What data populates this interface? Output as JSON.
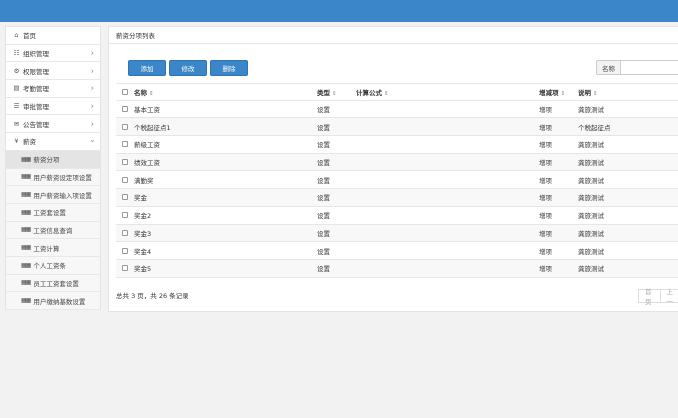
{
  "sidebar": {
    "menu": [
      {
        "label": "首页",
        "icon": "home-icon"
      },
      {
        "label": "组织管理",
        "icon": "org-chart-icon"
      },
      {
        "label": "权限管理",
        "icon": "cogs-icon"
      },
      {
        "label": "考勤管理",
        "icon": "calendar-icon"
      },
      {
        "label": "审批管理",
        "icon": "list-icon"
      },
      {
        "label": "公告管理",
        "icon": "bullhorn-icon"
      },
      {
        "label": "薪资",
        "icon": "yen-icon"
      }
    ],
    "sub_items": [
      {
        "label": "薪资分项"
      },
      {
        "label": "用户薪资设定项设置"
      },
      {
        "label": "用户薪资输入项设置"
      },
      {
        "label": "工资套设置"
      },
      {
        "label": "工资信息查询"
      },
      {
        "label": "工资计算"
      },
      {
        "label": "个人工资条"
      },
      {
        "label": "员工工资套设置"
      },
      {
        "label": "用户缴纳基数设置"
      }
    ]
  },
  "panel": {
    "title": "薪资分项列表",
    "buttons": {
      "add": "添加",
      "edit": "修改",
      "delete": "删除"
    },
    "search": {
      "label": "名称",
      "value": "",
      "placeholder": ""
    }
  },
  "table": {
    "headers": {
      "name": "名称",
      "type": "类型",
      "formula": "计算公式",
      "inc": "增减项",
      "desc": "说明"
    },
    "rows": [
      {
        "name": "基本工资",
        "type": "设置",
        "formula": "",
        "inc": "增项",
        "desc": "龚旅测试"
      },
      {
        "name": "个税起征点1",
        "type": "设置",
        "formula": "",
        "inc": "增项",
        "desc": "个税起征点"
      },
      {
        "name": "薪级工资",
        "type": "设置",
        "formula": "",
        "inc": "增项",
        "desc": "龚旅测试"
      },
      {
        "name": "绩效工资",
        "type": "设置",
        "formula": "",
        "inc": "增项",
        "desc": "龚旅测试"
      },
      {
        "name": "满勤奖",
        "type": "设置",
        "formula": "",
        "inc": "增项",
        "desc": "龚旅测试"
      },
      {
        "name": "奖金",
        "type": "设置",
        "formula": "",
        "inc": "增项",
        "desc": "龚旅测试"
      },
      {
        "name": "奖金2",
        "type": "设置",
        "formula": "",
        "inc": "增项",
        "desc": "龚旅测试"
      },
      {
        "name": "奖金3",
        "type": "设置",
        "formula": "",
        "inc": "增项",
        "desc": "龚旅测试"
      },
      {
        "name": "奖金4",
        "type": "设置",
        "formula": "",
        "inc": "增项",
        "desc": "龚旅测试"
      },
      {
        "name": "奖金5",
        "type": "设置",
        "formula": "",
        "inc": "增项",
        "desc": "龚旅测试"
      }
    ]
  },
  "footer": {
    "summary": "总共 3 页，共 26 条记录",
    "pager_first": "首页",
    "pager_prev": "上一"
  },
  "colors": {
    "primary": "#3b86c8",
    "topbar": "#3b86c8"
  }
}
